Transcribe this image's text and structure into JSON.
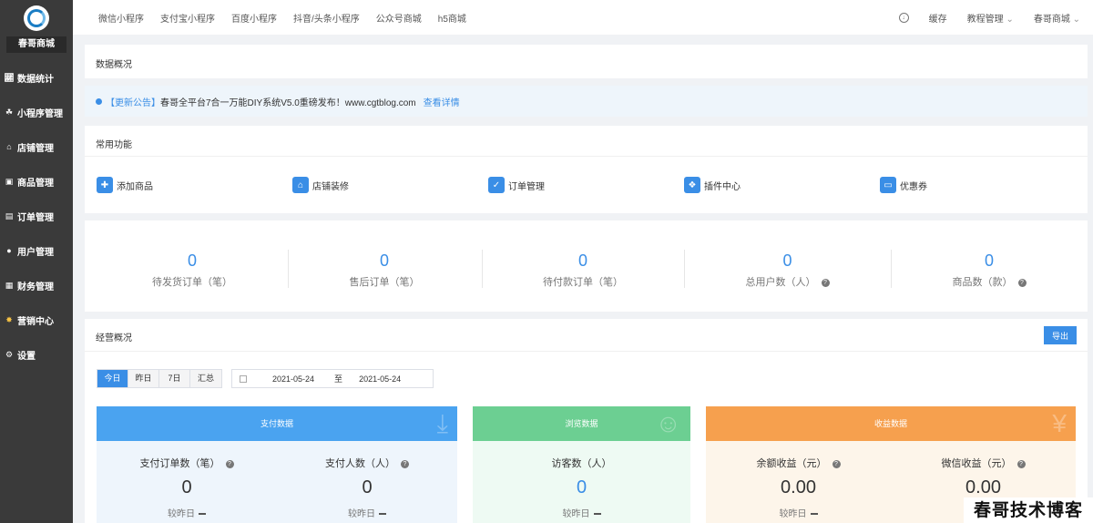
{
  "sidebar": {
    "shop_name": "春哥商城",
    "items": [
      {
        "label": "数据统计",
        "icon": "chart-icon"
      },
      {
        "label": "小程序管理",
        "icon": "miniapp-icon"
      },
      {
        "label": "店铺管理",
        "icon": "shop-icon"
      },
      {
        "label": "商品管理",
        "icon": "goods-icon"
      },
      {
        "label": "订单管理",
        "icon": "order-icon"
      },
      {
        "label": "用户管理",
        "icon": "user-icon"
      },
      {
        "label": "财务管理",
        "icon": "finance-icon"
      },
      {
        "label": "营销中心",
        "icon": "marketing-icon"
      },
      {
        "label": "设置",
        "icon": "settings-icon"
      }
    ]
  },
  "topbar": {
    "nav": [
      "微信小程序",
      "支付宝小程序",
      "百度小程序",
      "抖音/头条小程序",
      "公众号商城",
      "h5商城"
    ],
    "cache": "缓存",
    "tutorial": "教程管理",
    "shop": "春哥商城"
  },
  "overview": {
    "title": "数据概况"
  },
  "notice": {
    "tag": "【更新公告】",
    "text": "春哥全平台7合一万能DIY系统V5.0重磅发布！www.cgtblog.com",
    "link": "查看详情"
  },
  "common": {
    "title": "常用功能",
    "items": [
      {
        "label": "添加商品",
        "icon": "add-goods-icon"
      },
      {
        "label": "店铺装修",
        "icon": "home-icon"
      },
      {
        "label": "订单管理",
        "icon": "clipboard-icon"
      },
      {
        "label": "插件中心",
        "icon": "plugin-icon"
      },
      {
        "label": "优惠券",
        "icon": "coupon-icon"
      }
    ]
  },
  "stats": [
    {
      "value": "0",
      "label": "待发货订单（笔）"
    },
    {
      "value": "0",
      "label": "售后订单（笔）"
    },
    {
      "value": "0",
      "label": "待付款订单（笔）"
    },
    {
      "value": "0",
      "label": "总用户数（人）",
      "help": true
    },
    {
      "value": "0",
      "label": "商品数（款）",
      "help": true
    }
  ],
  "business": {
    "title": "经营概况",
    "export": "导出",
    "ranges": [
      "今日",
      "昨日",
      "7日",
      "汇总"
    ],
    "active_range": "今日",
    "date_start": "2021-05-24",
    "date_sep": "至",
    "date_end": "2021-05-24"
  },
  "cards": [
    {
      "title": "支付数据",
      "color": "#4aa3f0",
      "bg": "#eef5fc",
      "metrics": [
        {
          "label": "支付订单数（笔）",
          "value": "0",
          "compare": "较昨日"
        },
        {
          "label": "支付人数（人）",
          "value": "0",
          "compare": "较昨日"
        }
      ]
    },
    {
      "title": "浏览数据",
      "color": "#6ccf92",
      "bg": "#eefaf3",
      "metrics": [
        {
          "label": "访客数（人）",
          "value": "0",
          "compare": "较昨日"
        }
      ]
    },
    {
      "title": "收益数据",
      "color": "#f6a04e",
      "bg": "#fdf5ea",
      "metrics": [
        {
          "label": "余额收益（元）",
          "value": "0.00",
          "compare": "较昨日"
        },
        {
          "label": "微信收益（元）",
          "value": "0.00",
          "compare": ""
        }
      ]
    }
  ],
  "watermark": "春哥技术博客"
}
